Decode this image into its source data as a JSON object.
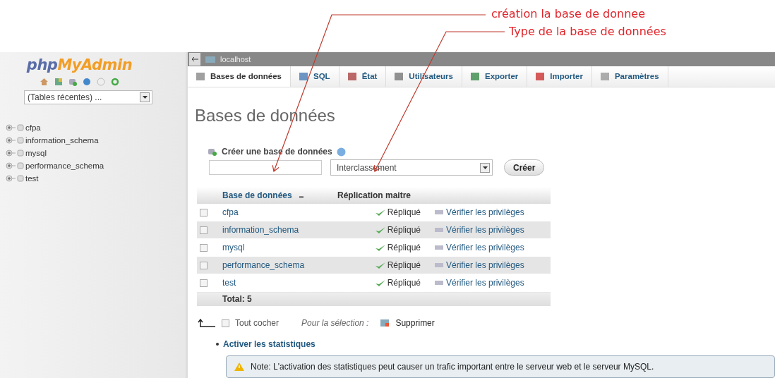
{
  "annotations": [
    {
      "text": "création la base de donnee"
    },
    {
      "text": "Type de la base de données"
    }
  ],
  "sidebar": {
    "logo": {
      "prefix": "php",
      "suffix": "MyAdmin"
    },
    "recent_tables": "(Tables récentes) ...",
    "databases": [
      {
        "name": "cfpa",
        "expanded": false
      },
      {
        "name": "information_schema",
        "expanded": false
      },
      {
        "name": "mysql",
        "expanded": false
      },
      {
        "name": "performance_schema",
        "expanded": false
      },
      {
        "name": "test",
        "expanded": false
      }
    ]
  },
  "breadcrumb": "localhost",
  "tabs": [
    {
      "label": "Bases de données",
      "selected": true
    },
    {
      "label": "SQL",
      "selected": false
    },
    {
      "label": "État",
      "selected": false
    },
    {
      "label": "Utilisateurs",
      "selected": false
    },
    {
      "label": "Exporter",
      "selected": false
    },
    {
      "label": "Importer",
      "selected": false
    },
    {
      "label": "Paramètres",
      "selected": false
    }
  ],
  "heading": "Bases de données",
  "create": {
    "label": "Créer une base de données",
    "collation": "Interclassement",
    "button": "Créer"
  },
  "table": {
    "columns": [
      "Base de données",
      "Réplication maitre"
    ],
    "rows": [
      {
        "name": "cfpa",
        "checked": false,
        "replication": "Répliqué",
        "action": "Vérifier les privilèges"
      },
      {
        "name": "information_schema",
        "checked": false,
        "replication": "Répliqué",
        "action": "Vérifier les privilèges"
      },
      {
        "name": "mysql",
        "checked": false,
        "replication": "Répliqué",
        "action": "Vérifier les privilèges"
      },
      {
        "name": "performance_schema",
        "checked": false,
        "replication": "Répliqué",
        "action": "Vérifier les privilèges"
      },
      {
        "name": "test",
        "checked": false,
        "replication": "Répliqué",
        "action": "Vérifier les privilèges"
      }
    ],
    "total": "Total: 5"
  },
  "footer": {
    "check_all": {
      "label": "Tout cocher",
      "checked": false
    },
    "selection_label": "Pour la sélection :",
    "delete": "Supprimer"
  },
  "stats_link": "Activer les statistiques",
  "note": "Note: L'activation des statistiques peut causer un trafic important entre le serveur web et le serveur MySQL."
}
